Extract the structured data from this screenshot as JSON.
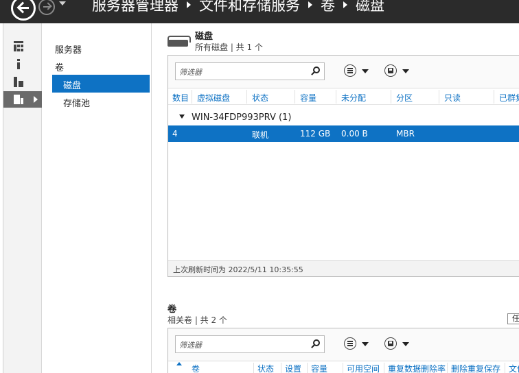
{
  "titlebar": {
    "breadcrumbs": [
      "服务器管理器",
      "文件和存储服务",
      "卷",
      "磁盘"
    ]
  },
  "rail": {
    "items": [
      {
        "icon": "dashboard-icon"
      },
      {
        "icon": "info-icon"
      },
      {
        "icon": "all-servers-icon"
      },
      {
        "icon": "file-storage-icon",
        "selected": true
      }
    ]
  },
  "tree": {
    "items": [
      {
        "label": "服务器"
      },
      {
        "label": "卷"
      },
      {
        "label": "磁盘",
        "selected": true
      },
      {
        "label": "存储池"
      }
    ]
  },
  "disks": {
    "title": "磁盘",
    "subtitle": "所有磁盘 | 共 1 个",
    "filter_placeholder": "筛选器",
    "columns": [
      "数目",
      "虚拟磁盘",
      "状态",
      "容量",
      "未分配",
      "分区",
      "只读",
      "已群集"
    ],
    "group_label": "WIN-34FDP993PRV (1)",
    "rows": [
      {
        "number": "4",
        "virtual_disk": "",
        "status": "联机",
        "capacity": "112 GB",
        "unallocated": "0.00 B",
        "partition": "MBR",
        "readonly": "",
        "clustered": ""
      }
    ],
    "footer": "上次刷新时间为 2022/5/11 10:35:55"
  },
  "volumes": {
    "title": "卷",
    "subtitle": "相关卷 | 共 2 个",
    "tasks_label": "任务",
    "filter_placeholder": "筛选器",
    "columns": [
      "卷",
      "状态",
      "设置",
      "容量",
      "可用空间",
      "重复数据删除率",
      "删除重复保存",
      "文件系统"
    ]
  },
  "colors": {
    "accent": "#0e72c4",
    "titlebar": "#2b2b2b",
    "rail_selected": "#6a6a6a"
  }
}
